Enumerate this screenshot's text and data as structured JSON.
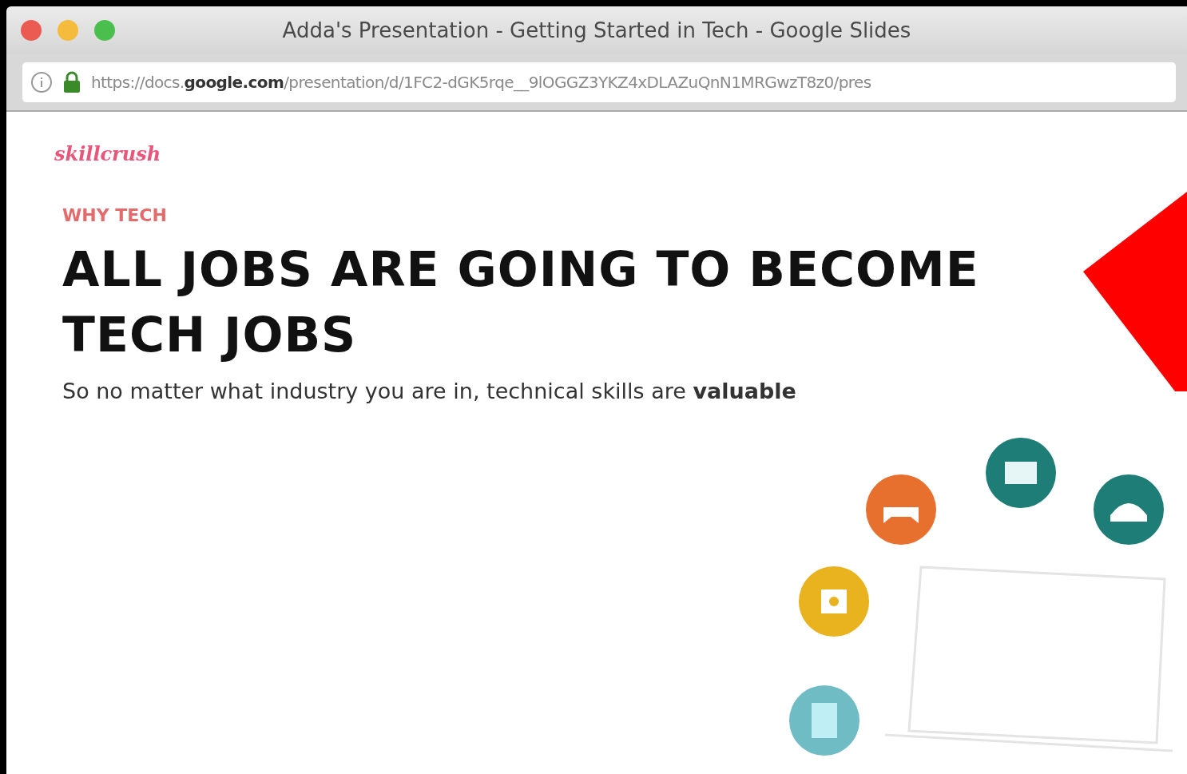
{
  "window": {
    "title": "Adda's Presentation - Getting Started in Tech - Google Slides"
  },
  "address_bar": {
    "url_start": "https://docs.",
    "url_domain": "google.com",
    "url_rest": "/presentation/d/1FC2-dGK5rqe__9lOGGZ3YKZ4xDLAZuQnN1MRGwzT8z0/pres",
    "secure": true
  },
  "slide": {
    "logo": "skillcrush",
    "eyebrow": "WHY TECH",
    "heading": "ALL JOBS ARE GOING TO BECOME TECH JOBS",
    "subtitle": "So no matter what industry you are in, technical skills are **valuable**"
  }
}
